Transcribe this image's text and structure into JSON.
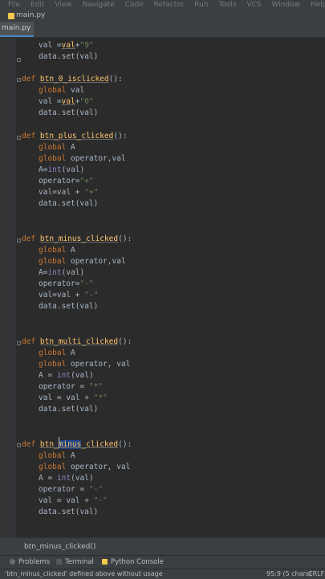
{
  "menu": [
    "File",
    "Edit",
    "View",
    "Navigate",
    "Code",
    "Refactor",
    "Run",
    "Tools",
    "VCS",
    "Window",
    "Help"
  ],
  "breadcrumb": {
    "file": "main.py"
  },
  "tabs": [
    {
      "label": "main.py"
    }
  ],
  "code": {
    "l01": {
      "a": "val =",
      "b": "val",
      "c": "+",
      "d": "\"9\""
    },
    "l02": {
      "a": "data.set(val)"
    },
    "l03": {
      "a": "def ",
      "b": "btn_0_isclicked",
      "c": "():"
    },
    "l04": {
      "a": "global ",
      "b": "val"
    },
    "l05": {
      "a": "val =",
      "b": "val",
      "c": "+",
      "d": "\"0\""
    },
    "l06": {
      "a": "data.set(val)"
    },
    "l07": {
      "a": "def ",
      "b": "btn_plus_clicked",
      "c": "():"
    },
    "l08": {
      "a": "global ",
      "b": "A"
    },
    "l09": {
      "a": "global ",
      "b": "operator,val"
    },
    "l10": {
      "a": "A=",
      "b": "int",
      "c": "(val)"
    },
    "l11": {
      "a": "operator=",
      "b": "\"+\""
    },
    "l12": {
      "a": "val=val + ",
      "b": "\"+\""
    },
    "l13": {
      "a": "data.set(val)"
    },
    "l14": {
      "a": "def ",
      "b": "btn_minus_clicked",
      "c": "():"
    },
    "l15": {
      "a": "global ",
      "b": "A"
    },
    "l16": {
      "a": "global ",
      "b": "operator,val"
    },
    "l17": {
      "a": "A=",
      "b": "int",
      "c": "(val)"
    },
    "l18": {
      "a": "operator=",
      "b": "\"-\""
    },
    "l19": {
      "a": "val=val + ",
      "b": "\"-\""
    },
    "l20": {
      "a": "data.set(val)"
    },
    "l21": {
      "a": "def ",
      "b": "btn_multi_clicked",
      "c": "():"
    },
    "l22": {
      "a": "global ",
      "b": "A"
    },
    "l23": {
      "a": "global ",
      "b": "operator, val"
    },
    "l24": {
      "a": "A = ",
      "b": "int",
      "c": "(val)"
    },
    "l25": {
      "a": "operator = ",
      "b": "\"*\""
    },
    "l26": {
      "a": "val = val + ",
      "b": "\"*\""
    },
    "l27": {
      "a": "data.set(val)"
    },
    "l28": {
      "a": "def ",
      "b": "btn_",
      "c": "minus",
      "d": "_clicked",
      "e": "():"
    },
    "l29": {
      "a": "global ",
      "b": "A"
    },
    "l30": {
      "a": "global ",
      "b": "operator, val"
    },
    "l31": {
      "a": "A = ",
      "b": "int",
      "c": "(val)"
    },
    "l32": {
      "a": "operator = ",
      "b": "\"-\""
    },
    "l33": {
      "a": "val = val + ",
      "b": "\"-\""
    },
    "l34": {
      "a": "data.set(val)"
    }
  },
  "bottom_breadcrumb": "btn_minus_clicked()",
  "toolwindows": {
    "problems": "Problems",
    "terminal": "Terminal",
    "python_console": "Python Console"
  },
  "status": {
    "message": "'btn_minus_clicked' defined above without usage",
    "position": "95:9 (5 chars)",
    "line_sep": "CRLF"
  },
  "colors": {
    "keyword": "#cc7832",
    "function": "#ffc66d",
    "string": "#6a8759",
    "builtin": "#8888c6",
    "selection": "#214283"
  }
}
